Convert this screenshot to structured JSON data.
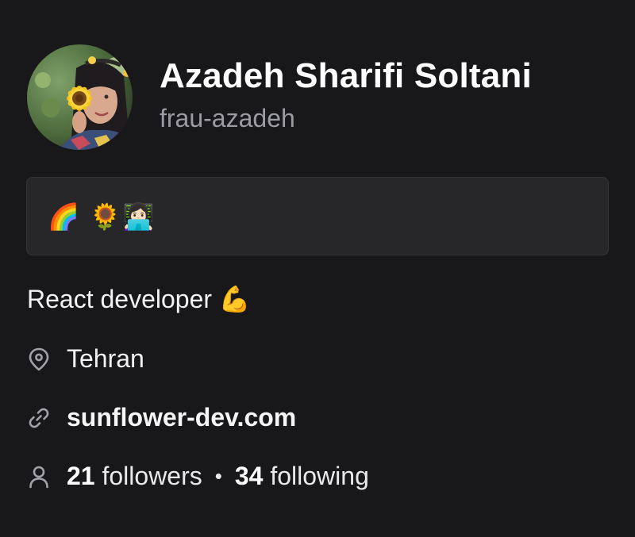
{
  "profile": {
    "display_name": "Azadeh Sharifi Soltani",
    "username": "frau-azadeh",
    "avatar_icon": "avatar-photo-sunflower"
  },
  "status": {
    "emoji": "🌈 🌻👩🏻‍💻"
  },
  "bio": "React developer 💪",
  "location": {
    "icon": "location-pin-icon",
    "text": "Tehran"
  },
  "website": {
    "icon": "link-icon",
    "text": "sunflower-dev.com"
  },
  "follows": {
    "icon": "person-icon",
    "followers_count": "21",
    "followers_label": "followers",
    "separator": "•",
    "following_count": "34",
    "following_label": "following"
  },
  "colors": {
    "background": "#18181b",
    "status_box": "#27272a",
    "muted_text": "#9b9ba3",
    "icon": "#a1a1aa"
  }
}
